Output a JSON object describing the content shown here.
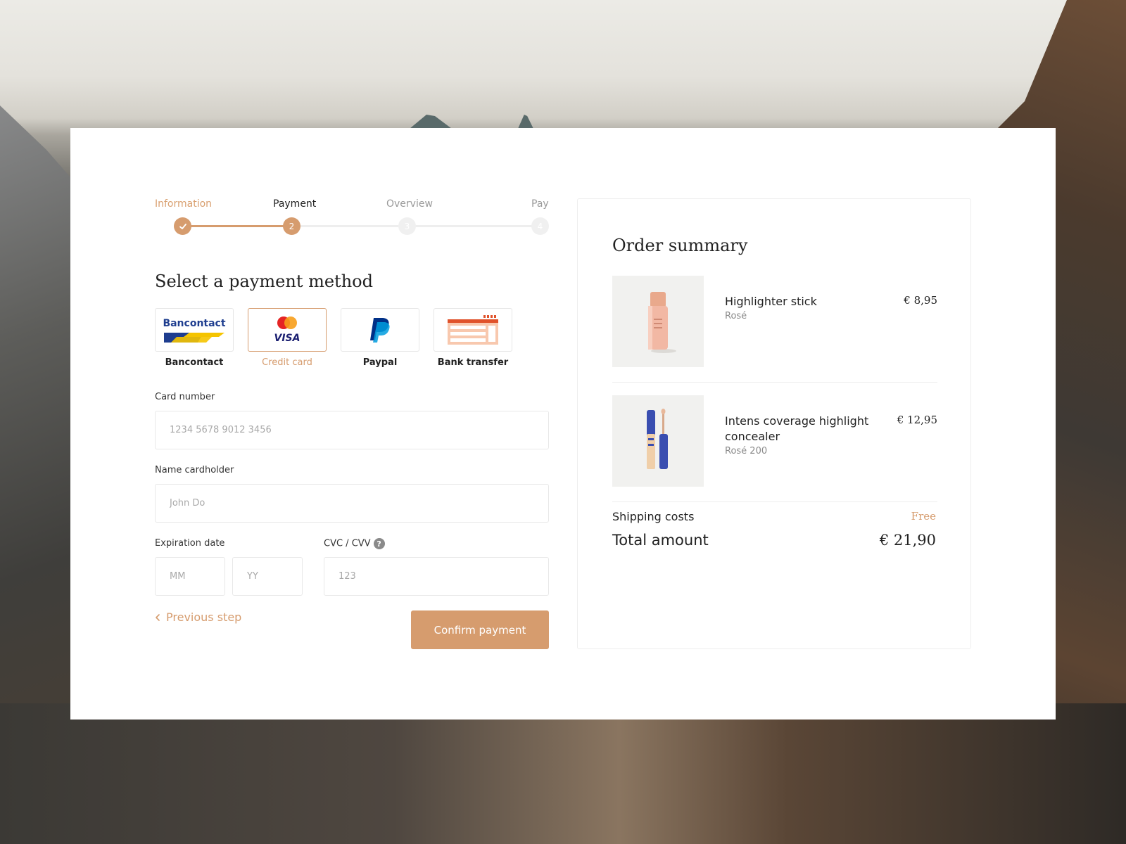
{
  "stepper": {
    "steps": [
      {
        "label": "Information",
        "status": "done"
      },
      {
        "label": "Payment",
        "status": "active",
        "number": "2"
      },
      {
        "label": "Overview",
        "status": "pending",
        "number": "3"
      },
      {
        "label": "Pay",
        "status": "pending",
        "number": "4"
      }
    ]
  },
  "payment": {
    "title": "Select a payment method",
    "methods": [
      {
        "label": "Bancontact",
        "logo_text": "Bancontact"
      },
      {
        "label": "Credit card",
        "logo_text": "VISA"
      },
      {
        "label": "Paypal"
      },
      {
        "label": "Bank transfer"
      }
    ],
    "card_number": {
      "label": "Card number",
      "placeholder": "1234 5678 9012 3456"
    },
    "cardholder": {
      "label": "Name cardholder",
      "placeholder": "John Do"
    },
    "expiration": {
      "label": "Expiration date",
      "month_placeholder": "MM",
      "year_placeholder": "YY"
    },
    "cvc": {
      "label": "CVC / CVV",
      "help": "?",
      "placeholder": "123"
    },
    "prev_label": "Previous step",
    "confirm_label": "Confirm payment"
  },
  "summary": {
    "title": "Order summary",
    "items": [
      {
        "name": "Highlighter stick",
        "variant": "Rosé",
        "price": "€ 8,95"
      },
      {
        "name": "Intens coverage highlight concealer",
        "variant": "Rosé 200",
        "price": "€ 12,95"
      }
    ],
    "shipping_label": "Shipping costs",
    "shipping_value": "Free",
    "total_label": "Total amount",
    "total_value": "€ 21,90"
  },
  "colors": {
    "accent": "#d69c6e",
    "text": "#222222",
    "muted": "#8a8a8a",
    "border": "#e8e8e8"
  }
}
